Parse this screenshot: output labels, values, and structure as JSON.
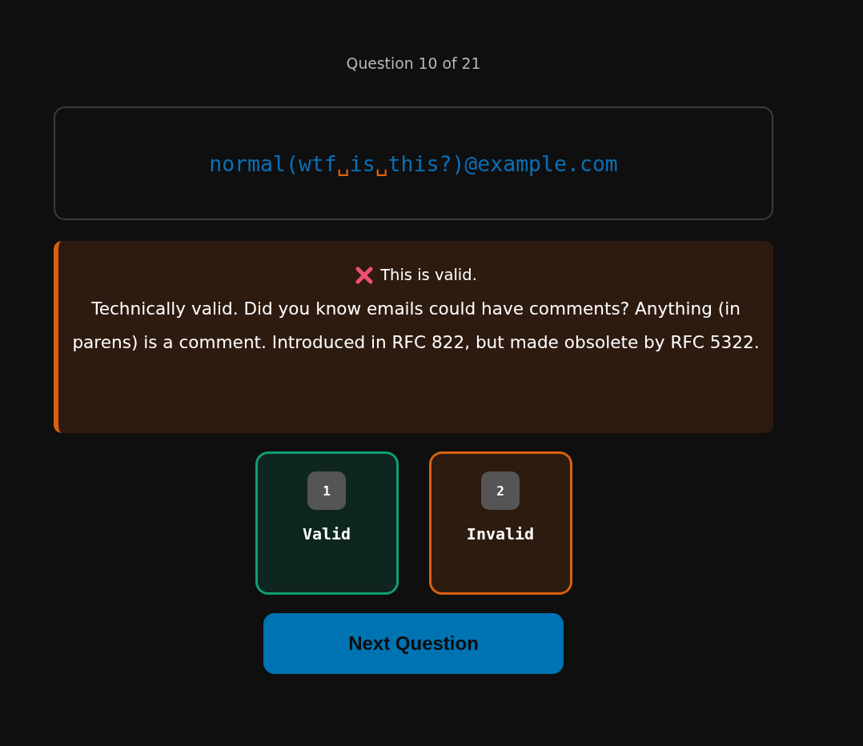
{
  "progress": "Question 10 of 21",
  "address": {
    "segments": [
      {
        "kind": "text",
        "text": "normal(wtf"
      },
      {
        "kind": "space_mark",
        "text": "␣"
      },
      {
        "kind": "text",
        "text": "is"
      },
      {
        "kind": "space_mark",
        "text": "␣"
      },
      {
        "kind": "text",
        "text": "this?)@example.com"
      }
    ]
  },
  "feedback": {
    "correct": false,
    "verdict": "This is valid.",
    "explanation": "Technically valid. Did you know emails could have comments? Anything (in parens) is a comment. Introduced in RFC 822, but made obsolete by RFC 5322."
  },
  "options": [
    {
      "key": "1",
      "label": "Valid",
      "selected": false,
      "correct": true
    },
    {
      "key": "2",
      "label": "Invalid",
      "selected": true,
      "correct": false
    }
  ],
  "next_button": "Next Question"
}
